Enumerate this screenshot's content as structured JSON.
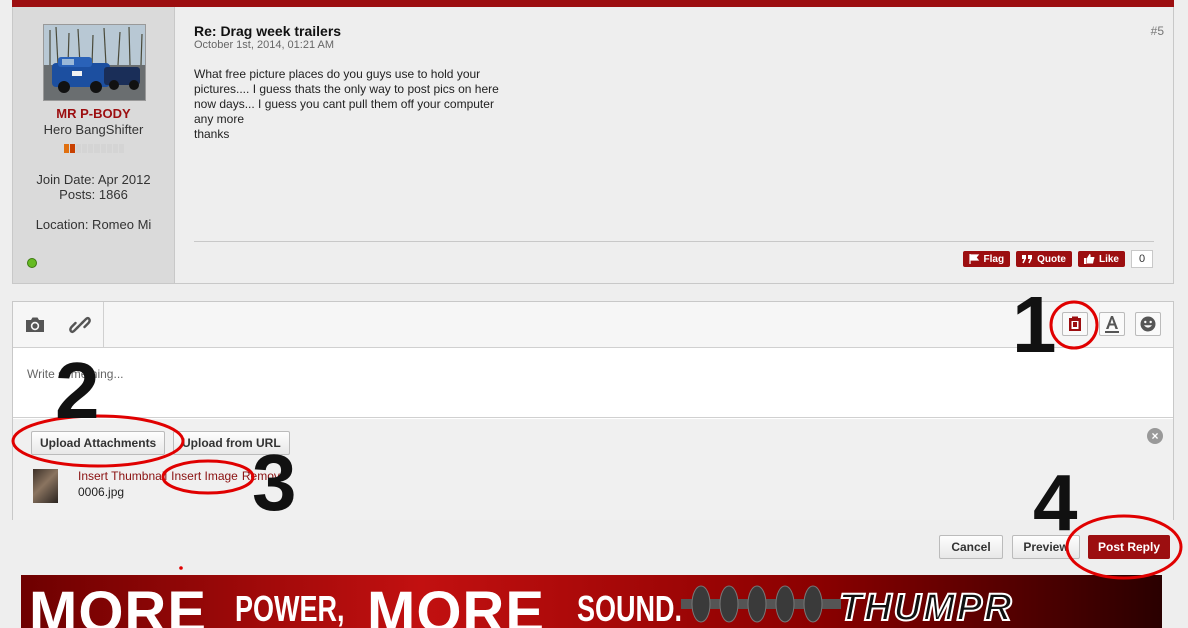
{
  "post": {
    "user": {
      "name": "MR P-BODY",
      "title": "Hero BangShifter",
      "join_date": "Join Date: Apr 2012",
      "posts": "Posts: 1866",
      "location": "Location: Romeo Mi"
    },
    "title": "Re: Drag week trailers",
    "date": "October 1st, 2014, 01:21 AM",
    "number": "#5",
    "body_lines": [
      "What free picture places do you guys use to hold your",
      "pictures.... I guess thats the only way to post pics on here",
      "now days... I guess you cant pull them off your computer",
      "any more",
      "thanks"
    ],
    "actions": {
      "flag": "Flag",
      "quote": "Quote",
      "like": "Like",
      "like_count": "0"
    }
  },
  "editor": {
    "placeholder": "Write something...",
    "upload_attachments": "Upload Attachments",
    "upload_from_url": "Upload from URL",
    "insert_thumbnail": "Insert Thumbnail",
    "insert_image": "Insert Image",
    "remove": "Remove",
    "filename": "0006.jpg",
    "close_symbol": "×"
  },
  "footer": {
    "cancel": "Cancel",
    "preview": "Preview",
    "post_reply": "Post Reply"
  },
  "banner": {
    "more1": "MORE",
    "power": "POWER,",
    "more2": "MORE",
    "sound": "SOUND.",
    "brand": "THUMPR"
  },
  "annotations": {
    "step1": "1",
    "step2": "2",
    "step3": "3",
    "step4": "4"
  },
  "colors": {
    "brand_red": "#9c0e10",
    "annotation_red": "#e00000"
  }
}
